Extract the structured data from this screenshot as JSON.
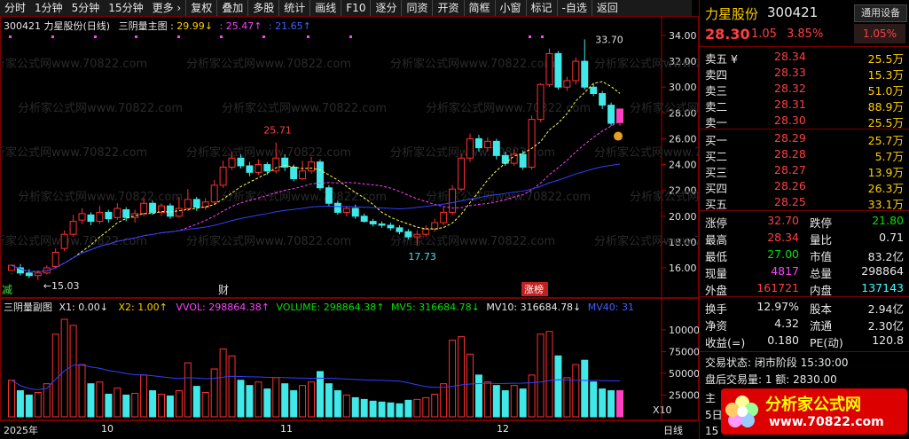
{
  "toolbar": {
    "items": [
      "分时",
      "1分钟",
      "5分钟",
      "15分钟",
      "更多 ›",
      "复权",
      "叠加",
      "多股",
      "统计",
      "画线",
      "F10",
      "逐分",
      "同资",
      "开资",
      "简框",
      "小窗",
      "标记",
      "-自选",
      "返回"
    ]
  },
  "main": {
    "stock": "300421 力星股份(日线)",
    "indicator": "三阴量主图 :",
    "v1": "29.99↓",
    "v2": ": 25.47↑",
    "v3": ": 21.65↑",
    "watermark": "分析家公式网www.70822.com",
    "yticks": [
      "34.00",
      "32.00",
      "30.00",
      "28.00",
      "26.00",
      "24.00",
      "22.00",
      "20.00",
      "18.00",
      "16.00"
    ],
    "ann_high": "33.70",
    "ann_mid": "25.71",
    "ann_low": "17.73",
    "ann_start": "←15.03",
    "mark_left": "减",
    "mark_cai": "财",
    "mark_zhang": "涨榜"
  },
  "sub": {
    "name": "三阴量副图",
    "x1": "X1: 0.00↓",
    "x2": "X2: 1.00↑",
    "vvol": "VVOL: 298864.38↑",
    "volume": "VOLUME: 298864.38↑",
    "mv5": "MV5: 316684.78↓",
    "mv10": "MV10: 316684.78↓",
    "mv40": "MV40: 31",
    "yticks": [
      "100000",
      "75000",
      "50000",
      "25000"
    ],
    "unit": "X10"
  },
  "dates": [
    "2025年",
    "10",
    "11",
    "12",
    "日线"
  ],
  "quote": {
    "name": "力星股份",
    "code": "300421",
    "btn": "通用设备",
    "price": "28.30",
    "change": "1.05",
    "pct": "3.85%",
    "pct2": "1.05%",
    "asks": [
      {
        "label": "卖五 ¥",
        "price": "28.34",
        "vol": "25.5万"
      },
      {
        "label": "卖四",
        "price": "28.33",
        "vol": "15.3万"
      },
      {
        "label": "卖三",
        "price": "28.32",
        "vol": "51.0万"
      },
      {
        "label": "卖二",
        "price": "28.31",
        "vol": "88.9万"
      },
      {
        "label": "卖一",
        "price": "28.30",
        "vol": "25.5万"
      }
    ],
    "bids": [
      {
        "label": "买一",
        "price": "28.29",
        "vol": "25.7万"
      },
      {
        "label": "买二",
        "price": "28.28",
        "vol": "5.7万"
      },
      {
        "label": "买三",
        "price": "28.27",
        "vol": "13.9万"
      },
      {
        "label": "买四",
        "price": "28.26",
        "vol": "26.3万"
      },
      {
        "label": "买五",
        "price": "28.25",
        "vol": "33.1万"
      }
    ],
    "stats1": [
      {
        "l1": "涨停",
        "v1": "32.70",
        "l2": "跌停",
        "v2": "21.80"
      },
      {
        "l1": "最高",
        "v1": "28.34",
        "l2": "量比",
        "v2": "0.71"
      },
      {
        "l1": "最低",
        "v1": "27.00",
        "l2": "市值",
        "v2": "83.2亿"
      },
      {
        "l1": "现量",
        "v1": "4817",
        "l2": "总量",
        "v2": "298864"
      },
      {
        "l1": "外盘",
        "v1": "161721",
        "l2": "内盘",
        "v2": "137143"
      }
    ],
    "stats2": [
      {
        "l1": "换手",
        "v1": "12.97%",
        "l2": "股本",
        "v2": "2.94亿"
      },
      {
        "l1": "净资",
        "v1": "4.32",
        "l2": "流通",
        "v2": "2.30亿"
      },
      {
        "l1": "收益(=)",
        "v1": "0.180",
        "l2": "PE(动)",
        "v2": "120.8"
      }
    ],
    "trade_state": "交易状态: 闭市阶段 15:30:00",
    "after_hours": "盘后交易量: 1  额: 2830.00",
    "cut1": "主",
    "cut2": "5日",
    "cut3": "15"
  },
  "logo": {
    "text": "分析家公式网",
    "url": "www.70822.com"
  }
}
